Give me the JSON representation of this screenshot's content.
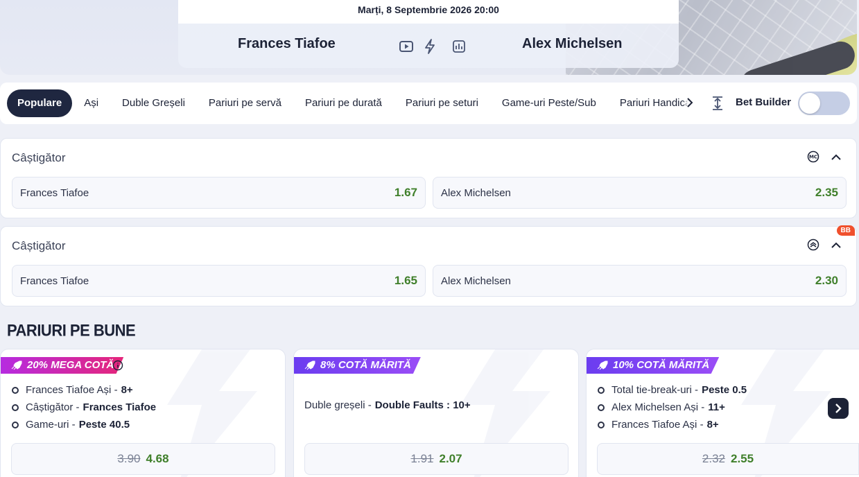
{
  "header": {
    "date": "Marți, 8 Septembrie 2026 20:00",
    "home_team": "Frances Tiafoe",
    "away_team": "Alex Michelsen",
    "icons": [
      "video-icon",
      "lightning-icon",
      "stats-icon"
    ]
  },
  "tabs": {
    "items": [
      "Populare",
      "Ași",
      "Duble Greșeli",
      "Pariuri pe servă",
      "Pariuri pe durată",
      "Pariuri pe seturi",
      "Game-uri Peste/Sub",
      "Pariuri Handicap"
    ],
    "active": "Populare",
    "bet_builder_label": "Bet Builder"
  },
  "markets": [
    {
      "title": "Câștigător",
      "badge_icon": "mc-icon",
      "selections": [
        {
          "name": "Frances Tiafoe",
          "odd": "1.67"
        },
        {
          "name": "Alex Michelsen",
          "odd": "2.35"
        }
      ]
    },
    {
      "title": "Câștigător",
      "badge_icon": "bb-stack-icon",
      "corner_badge": "BB",
      "selections": [
        {
          "name": "Frances Tiafoe",
          "odd": "1.65"
        },
        {
          "name": "Alex Michelsen",
          "odd": "2.30"
        }
      ]
    }
  ],
  "section": {
    "title": "PARIURI PE BUNE"
  },
  "promos": [
    {
      "ribbon": "20% MEGA COTĂ",
      "color": "#d12aa8",
      "legs": [
        {
          "market": "Frances Tiafoe Ași",
          "pick": "8+"
        },
        {
          "market": "Câștigător",
          "pick": "Frances Tiafoe"
        },
        {
          "market": "Game-uri",
          "pick": "Peste 40.5"
        }
      ],
      "old_odd": "3.90",
      "new_odd": "4.68"
    },
    {
      "ribbon": "8% COTĂ MĂRITĂ",
      "color": "#7b45f3",
      "single": {
        "market": "Duble greșeli",
        "pick": "Double Faults : 10+"
      },
      "old_odd": "1.91",
      "new_odd": "2.07"
    },
    {
      "ribbon": "10% COTĂ MĂRITĂ",
      "color": "#7b45f3",
      "legs": [
        {
          "market": "Total tie-break-uri",
          "pick": "Peste 0.5"
        },
        {
          "market": "Alex Michelsen Ași",
          "pick": "11+"
        },
        {
          "market": "Frances Tiafoe Ași",
          "pick": "8+"
        }
      ],
      "old_odd": "2.32",
      "new_odd": "2.55"
    }
  ]
}
